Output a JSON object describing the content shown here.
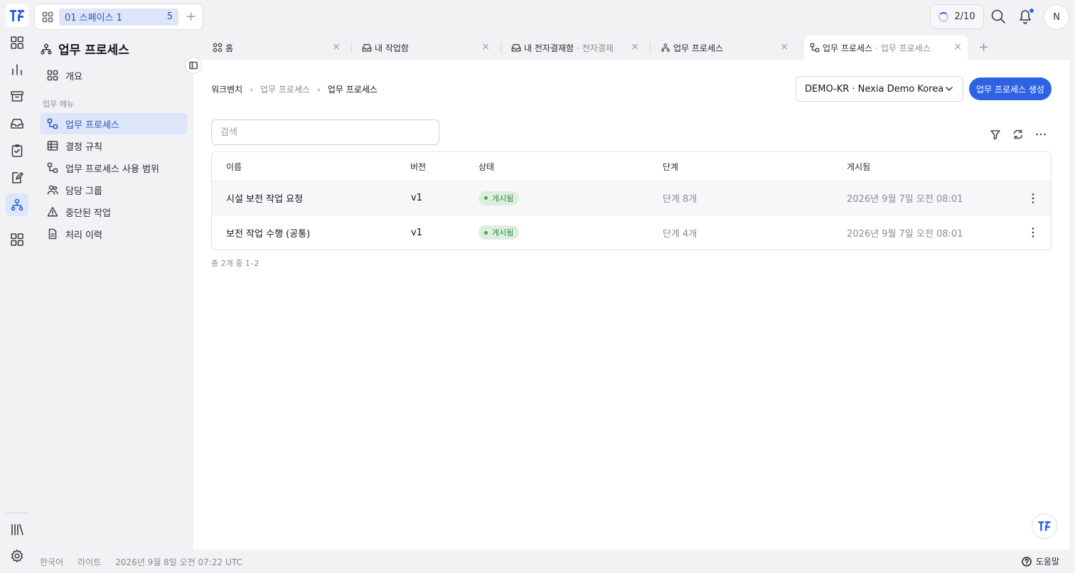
{
  "space": {
    "label": "01 스페이스 1",
    "count": "5"
  },
  "jobs": "2/10",
  "user": {
    "initial": "N"
  },
  "nav": {
    "title": "업무 프로세스",
    "overview": "개요",
    "section": "업무 메뉴",
    "items": [
      {
        "label": "업무 프로세스",
        "icon": "process-icon"
      },
      {
        "label": "결정 규칙",
        "icon": "table-icon"
      },
      {
        "label": "업무 프로세스 사용 범위",
        "icon": "process-icon"
      },
      {
        "label": "담당 그룹",
        "icon": "users-icon"
      },
      {
        "label": "중단된 작업",
        "icon": "warning-icon"
      },
      {
        "label": "처리 이력",
        "icon": "document-icon"
      }
    ]
  },
  "tabs": [
    {
      "label": "홈",
      "sub": ""
    },
    {
      "label": "내 작업함",
      "sub": ""
    },
    {
      "label": "내 전자결재함",
      "sub": "· 전자결재"
    },
    {
      "label": "업무 프로세스",
      "sub": ""
    },
    {
      "label": "업무 프로세스",
      "sub": "· 업무 프로세스"
    }
  ],
  "breadcrumb": [
    "워크벤치",
    "업무 프로세스",
    "업무 프로세스"
  ],
  "tenant": "DEMO-KR · Nexia Demo Korea",
  "create_label": "업무 프로세스 생성",
  "search_placeholder": "검색",
  "table": {
    "headers": [
      "이름",
      "버전",
      "상태",
      "단계",
      "게시됨"
    ],
    "rows": [
      {
        "name": "시설 보전 작업 요청",
        "version": "v1",
        "status": "게시됨",
        "steps": "단계 8개",
        "published": "2026년 9월 7일 오전 08:01"
      },
      {
        "name": "보전 작업 수행 (공통)",
        "version": "v1",
        "status": "게시됨",
        "steps": "단계 4개",
        "published": "2026년 9월 7일 오전 08:01"
      }
    ]
  },
  "pager": "총 2개 중 1–2",
  "footer": {
    "lang": "한국어",
    "theme": "라이트",
    "time": "2026년 9월 8일 오전 07:22 UTC",
    "help": "도움말"
  },
  "colors": {
    "accent": "#2d63e2",
    "status_green": "#2e8a45"
  }
}
